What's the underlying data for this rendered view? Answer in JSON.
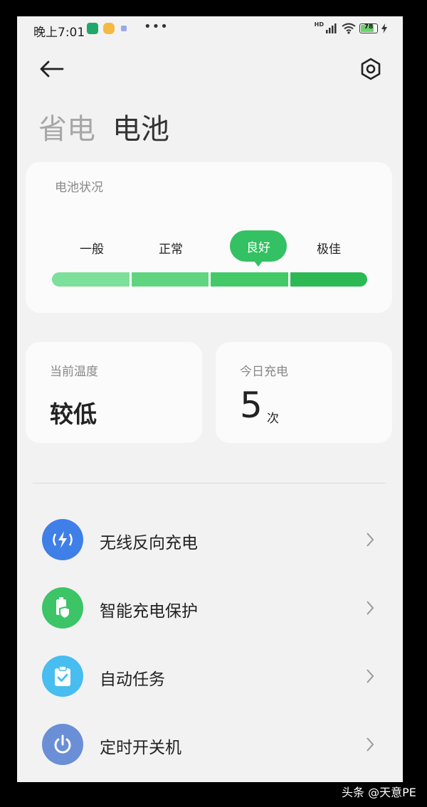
{
  "status_bar": {
    "time": "晚上7:01",
    "dots": "•••",
    "net": "HD",
    "battery": "78"
  },
  "header": {
    "tab_inactive": "省电",
    "tab_active": "电池"
  },
  "battery_status": {
    "title": "电池状况",
    "levels": [
      "一般",
      "正常",
      "良好",
      "极佳"
    ],
    "selected": "良好"
  },
  "temperature": {
    "label": "当前温度",
    "value": "较低"
  },
  "charges": {
    "label": "今日充电",
    "count": "5",
    "unit": "次"
  },
  "menu": [
    {
      "label": "无线反向充电",
      "icon": "wireless-charge-icon",
      "color": "#3f7fe8"
    },
    {
      "label": "智能充电保护",
      "icon": "battery-shield-icon",
      "color": "#3cc467"
    },
    {
      "label": "自动任务",
      "icon": "clipboard-check-icon",
      "color": "#47bdf0"
    },
    {
      "label": "定时开关机",
      "icon": "power-icon",
      "color": "#6a8fd6"
    }
  ],
  "colors": {
    "accent": "#34c163",
    "background": "#f2f2f2"
  },
  "watermark": "头条 @天意PE"
}
